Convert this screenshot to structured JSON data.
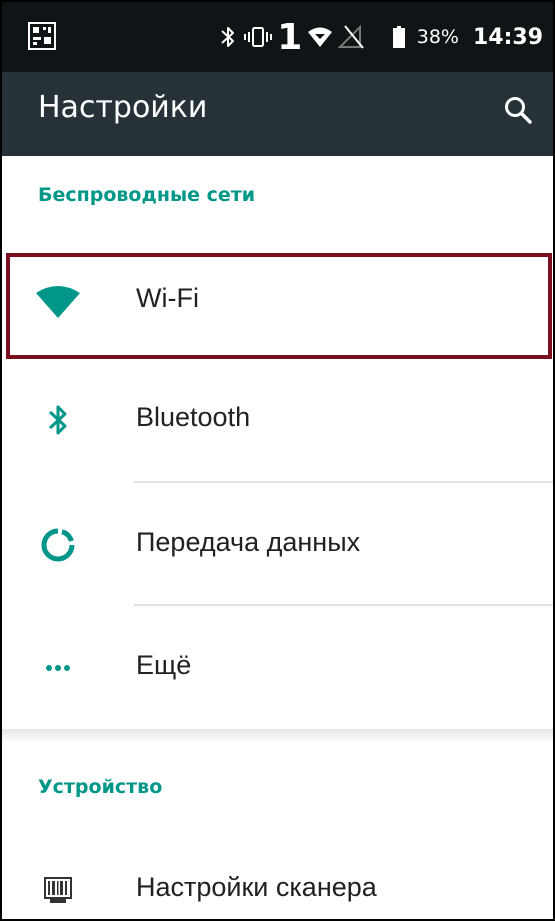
{
  "status_bar": {
    "battery_percent": "38%",
    "time": "14:39",
    "sim_indicator": "1",
    "icons": [
      "notification-app-icon",
      "bluetooth-icon",
      "vibrate-icon",
      "sim-1-icon",
      "wifi-signal-icon",
      "no-signal-icon",
      "battery-icon"
    ]
  },
  "toolbar": {
    "title": "Настройки",
    "search_icon": "search-icon"
  },
  "sections": [
    {
      "header": "Беспроводные сети",
      "items": [
        {
          "label": "Wi-Fi",
          "icon": "wifi-icon"
        },
        {
          "label": "Bluetooth",
          "icon": "bluetooth-icon"
        },
        {
          "label": "Передача данных",
          "icon": "data-usage-icon"
        },
        {
          "label": "Ещё",
          "icon": "more-icon"
        }
      ]
    },
    {
      "header": "Устройство",
      "items": [
        {
          "label": "Настройки сканера",
          "icon": "barcode-scanner-icon"
        }
      ]
    }
  ],
  "colors": {
    "status_bar": "#0f1416",
    "toolbar": "#263238",
    "accent": "#009688",
    "highlight_border": "#7a0f1f",
    "text_primary": "#212121"
  }
}
